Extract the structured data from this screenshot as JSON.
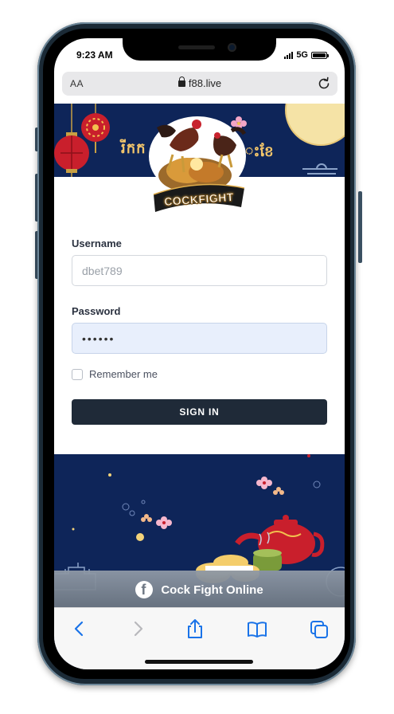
{
  "status_bar": {
    "time": "9:23 AM",
    "network": "5G"
  },
  "browser": {
    "text_size_button": "AA",
    "url": "f88.live"
  },
  "banner": {
    "heading_fragment": "រីកក",
    "logo_text": "COCKFIGHT"
  },
  "login_form": {
    "username_label": "Username",
    "username_placeholder": "dbet789",
    "password_label": "Password",
    "password_value": "••••••",
    "remember_label": "Remember me",
    "sign_in_label": "SIGN IN"
  },
  "facebook_bar": {
    "label": "Cock Fight Online",
    "icon": "facebook-icon"
  },
  "toolbar": {
    "icons": [
      "back-icon",
      "forward-icon",
      "share-icon",
      "bookmarks-icon",
      "tabs-icon"
    ]
  },
  "colors": {
    "banner_navy": "#0e2559",
    "button_dark": "#1f2a38",
    "ios_blue": "#1a73e8",
    "password_fill": "#e8effc"
  }
}
